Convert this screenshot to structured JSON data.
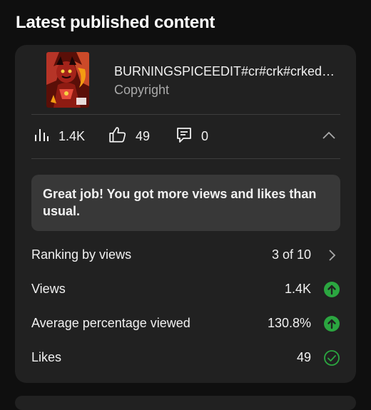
{
  "section": {
    "title": "Latest published content"
  },
  "video": {
    "title": "BURNINGSPICEEDIT#cr#crk#crked…",
    "subtitle": "Copyright",
    "thumbnail_icon": "video-thumbnail-red-character"
  },
  "stats": {
    "views": "1.4K",
    "likes": "49",
    "comments": "0"
  },
  "banner": {
    "text": "Great job! You got more views and likes than usual."
  },
  "metrics": [
    {
      "label": "Ranking by views",
      "value": "3 of 10",
      "icon": "chevron-right-icon"
    },
    {
      "label": "Views",
      "value": "1.4K",
      "icon": "arrow-up-green-icon"
    },
    {
      "label": "Average percentage viewed",
      "value": "130.8%",
      "icon": "arrow-up-green-icon"
    },
    {
      "label": "Likes",
      "value": "49",
      "icon": "check-circle-green-icon"
    }
  ],
  "colors": {
    "background": "#0f0f0f",
    "card": "#212121",
    "banner": "#383838",
    "positive": "#2ba640",
    "muted_text": "#aaaaaa"
  }
}
